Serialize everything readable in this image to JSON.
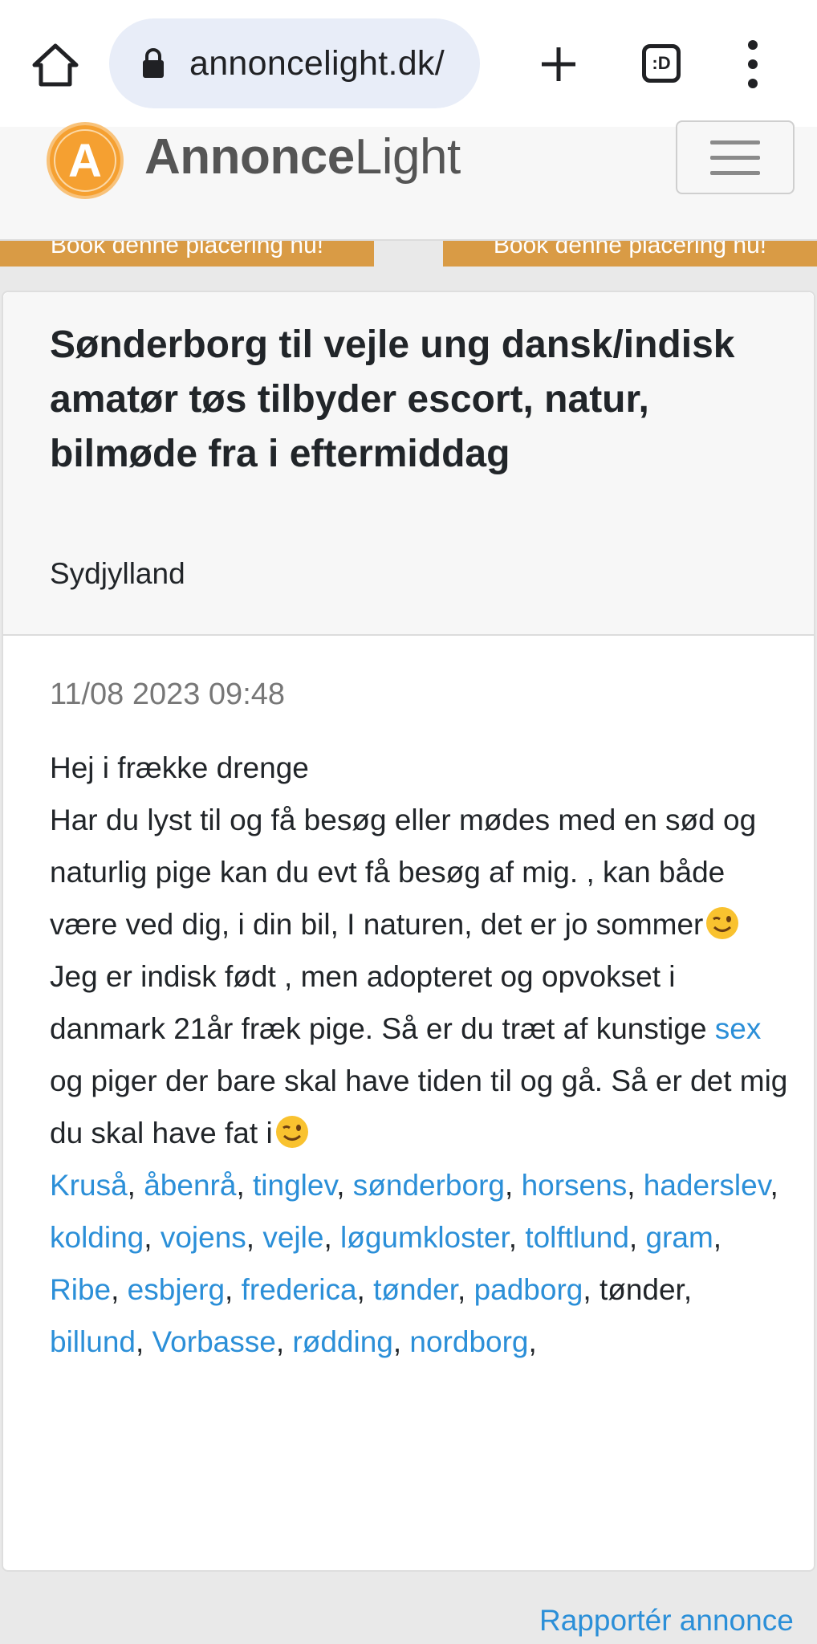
{
  "browser": {
    "url": "annoncelight.dk/",
    "tab_count_label": ":D"
  },
  "site": {
    "logo_letter": "A",
    "logo_bold": "Annonce",
    "logo_light": "Light"
  },
  "banners": {
    "left": "Book denne placering nu!",
    "right": "Book denne placering nu!"
  },
  "ad": {
    "title": "Sønderborg til vejle ung dansk/indisk amatør tøs tilbyder escort, natur, bilmøde fra i eftermiddag",
    "region": "Sydjylland",
    "timestamp": "11/08 2023 09:48",
    "line1": "Hej i frække drenge",
    "line2": "Har du lyst til og få besøg eller mødes med en sød og naturlig pige kan du evt få besøg af mig. , kan både være ved dig, i din bil, I naturen, det er jo sommer",
    "line3a": "Jeg er indisk født , men adopteret og opvokset i danmark 21år fræk pige. Så er du træt af kunstige ",
    "line3_link": "sex",
    "line3b": " og piger der bare skal have tiden til og gå. Så er det mig du skal have fat i",
    "towns": [
      {
        "text": "Kruså",
        "link": true
      },
      {
        "text": "åbenrå",
        "link": true
      },
      {
        "text": "tinglev",
        "link": true
      },
      {
        "text": "sønderborg",
        "link": true
      },
      {
        "text": "horsens",
        "link": true
      },
      {
        "text": "haderslev",
        "link": true
      },
      {
        "text": "kolding",
        "link": true
      },
      {
        "text": "vojens",
        "link": true
      },
      {
        "text": "vejle",
        "link": true
      },
      {
        "text": "løgumkloster",
        "link": true
      },
      {
        "text": "tolftlund",
        "link": true
      },
      {
        "text": "gram",
        "link": true
      },
      {
        "text": "Ribe",
        "link": true
      },
      {
        "text": "esbjerg",
        "link": true
      },
      {
        "text": "frederica",
        "link": true
      },
      {
        "text": "tønder",
        "link": true
      },
      {
        "text": "padborg",
        "link": true
      },
      {
        "text": "tønder",
        "link": false
      },
      {
        "text": "billund",
        "link": true
      },
      {
        "text": "Vorbasse",
        "link": true
      },
      {
        "text": "rødding",
        "link": true
      },
      {
        "text": "nordborg",
        "link": true
      }
    ]
  },
  "report_link": "Rapportér annonce",
  "colors": {
    "link": "#2b8fd8",
    "banner": "#d99b45",
    "logo_orange": "#f5a031"
  }
}
